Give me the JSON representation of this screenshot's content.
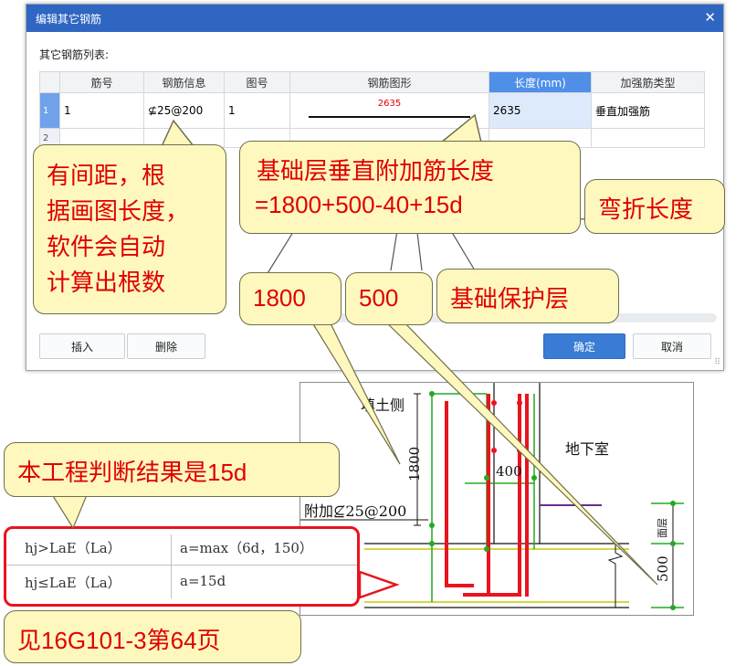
{
  "dialog": {
    "title": "编辑其它钢筋",
    "close_icon": "close-icon",
    "list_label": "其它钢筋列表:",
    "columns": [
      "筋号",
      "钢筋信息",
      "图号",
      "钢筋图形",
      "长度(mm)",
      "加强筋类型"
    ],
    "selected_column": "长度(mm)",
    "rows": [
      {
        "no": "1",
        "bar_no": "1",
        "info": "⊈25@200",
        "fig_no": "1",
        "shape_label": "2635",
        "length": "2635",
        "type": "垂直加强筋"
      },
      {
        "no": "2",
        "bar_no": "",
        "info": "",
        "fig_no": "",
        "shape_label": "",
        "length": "",
        "type": ""
      }
    ],
    "buttons": {
      "insert": "插入",
      "delete": "删除",
      "ok": "确定",
      "cancel": "取消"
    }
  },
  "callouts": {
    "spacing": "有间距，根\n据画图长度，\n软件会自动\n计算出根数",
    "formula_line1": "基础层垂直附加筋长度",
    "formula_line2": "=1800+500-40+15d",
    "bend": "弯折长度",
    "v1800": "1800",
    "v500": "500",
    "cover": "基础保护层",
    "result": "本工程判断结果是15d",
    "reference": "见16G101-3第64页"
  },
  "drawing": {
    "fill_side": "填土侧",
    "basement": "地下室",
    "dim_1800": "1800",
    "dim_400": "400",
    "extra_bar": "附加⊈25@200",
    "dim_500": "500",
    "top_label": "面层"
  },
  "code_table": {
    "r1c1": "hj>LaE（La）",
    "r1c2": "a=max（6d，150）",
    "r2c1": "hj≤LaE（La）",
    "r2c2": "a=15d"
  },
  "colors": {
    "title_bar": "#2f66c2",
    "callout_bg": "#fef8bf",
    "callout_text": "#e00000",
    "highlight": "#e8141e"
  }
}
